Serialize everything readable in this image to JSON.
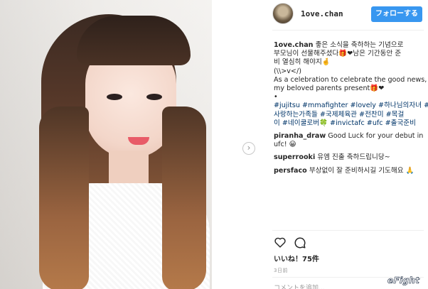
{
  "post": {
    "username": "1ove.chan",
    "follow_label": "フォローする"
  },
  "caption": {
    "username": "1ove.chan",
    "lines": [
      "좋은 소식을 축하하는 기념으로",
      "부모님이 선물해주셨다🎁❤남은 기간동안 준",
      "비 열심히 해야지🤞",
      "(\\\\>v</)",
      "As a celebration to celebrate the good news,",
      "my beloved parents present🎁❤",
      "•"
    ],
    "hashtag_lines": [
      "#jujitsu #mmafighter #lovely #하나님의자녀 #",
      "사랑하는가족들 #국제체육관 #전찬미 #목걸",
      "이 #네이쿨로버🍀 #invictafc #ufc #출국준비"
    ]
  },
  "comments": [
    {
      "username": "piranha_draw",
      "lines": [
        "Good Luck for your debut in",
        "ufc! 😀"
      ]
    },
    {
      "username": "superrooki",
      "lines": [
        "유엠 진출 축하드립니당~"
      ]
    },
    {
      "username": "persfaco",
      "lines": [
        "부상없이 잘 준비하시길 기도해요 🙏"
      ]
    }
  ],
  "likes_text": "いいね！75件",
  "time_ago": "3日前",
  "add_comment_placeholder": "コメントを追加...",
  "watermark": {
    "prefix": "e",
    "word": "Fight"
  },
  "icons": {
    "next": "chevron-right-icon",
    "like": "heart-icon",
    "comment": "comment-bubble-icon"
  },
  "colors": {
    "follow_button": "#3897f0",
    "hashtag": "#003569",
    "text": "#262626",
    "muted": "#999999"
  }
}
